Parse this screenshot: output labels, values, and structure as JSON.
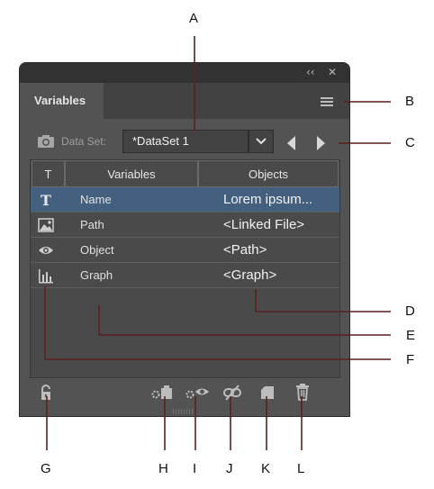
{
  "panel": {
    "collapse_glyph": "‹‹",
    "close_glyph": "✕",
    "tab_label": "Variables",
    "dataset_label": "Data Set:",
    "dataset_value": "*DataSet 1"
  },
  "table": {
    "col_type": "T",
    "col_variables": "Variables",
    "col_objects": "Objects",
    "rows": [
      {
        "icon": "text-type-icon",
        "variable": "Name",
        "object": "Lorem ipsum..."
      },
      {
        "icon": "image-icon",
        "variable": "Path",
        "object": "<Linked File>"
      },
      {
        "icon": "eye-icon",
        "variable": "Object",
        "object": "<Path>"
      },
      {
        "icon": "graph-icon",
        "variable": "Graph",
        "object": "<Graph>"
      }
    ]
  },
  "bottom_icons": [
    "lock-icon",
    "capture-dataset-icon",
    "make-visibility-dynamic-icon",
    "unbind-variable-icon",
    "new-variable-icon",
    "delete-icon"
  ],
  "callouts": [
    "A",
    "B",
    "C",
    "D",
    "E",
    "F",
    "G",
    "H",
    "I",
    "J",
    "K",
    "L"
  ],
  "colors": {
    "selected_row": "#44607f",
    "callout_line": "#e23a3a"
  }
}
